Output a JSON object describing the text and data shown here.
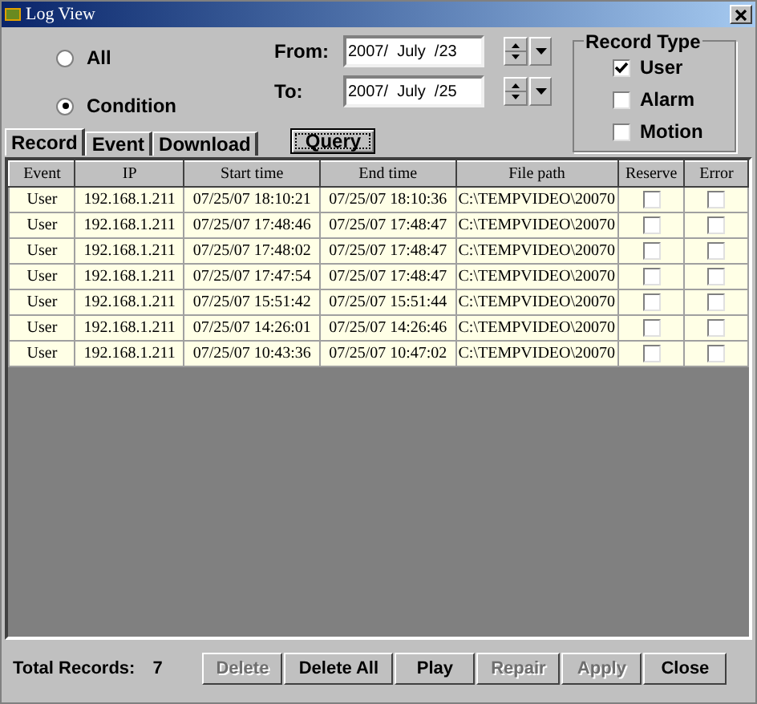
{
  "window": {
    "title": "Log View"
  },
  "range": [
    {
      "label": "All",
      "selected": false
    },
    {
      "label": "Condition",
      "selected": true
    }
  ],
  "dates": [
    {
      "label": "From:",
      "value": "2007/  July  /23"
    },
    {
      "label": "To:",
      "value": "2007/  July  /25"
    }
  ],
  "record_type": {
    "title": "Record Type",
    "options": [
      {
        "label": "User",
        "checked": true
      },
      {
        "label": "Alarm",
        "checked": false
      },
      {
        "label": "Motion",
        "checked": false
      }
    ]
  },
  "tabs": [
    {
      "label": "Record",
      "selected": true
    },
    {
      "label": "Event",
      "selected": false
    },
    {
      "label": "Download",
      "selected": false
    }
  ],
  "query_button": "Query",
  "table": {
    "columns": [
      "Event",
      "IP",
      "Start time",
      "End time",
      "File path",
      "Reserve",
      "Error"
    ],
    "rows": [
      {
        "event": "User",
        "ip": "192.168.1.211",
        "start": "07/25/07 18:10:21",
        "end": "07/25/07 18:10:36",
        "path": "C:\\TEMPVIDEO\\20070",
        "reserve": false,
        "error": false
      },
      {
        "event": "User",
        "ip": "192.168.1.211",
        "start": "07/25/07 17:48:46",
        "end": "07/25/07 17:48:47",
        "path": "C:\\TEMPVIDEO\\20070",
        "reserve": false,
        "error": false
      },
      {
        "event": "User",
        "ip": "192.168.1.211",
        "start": "07/25/07 17:48:02",
        "end": "07/25/07 17:48:47",
        "path": "C:\\TEMPVIDEO\\20070",
        "reserve": false,
        "error": false
      },
      {
        "event": "User",
        "ip": "192.168.1.211",
        "start": "07/25/07 17:47:54",
        "end": "07/25/07 17:48:47",
        "path": "C:\\TEMPVIDEO\\20070",
        "reserve": false,
        "error": false
      },
      {
        "event": "User",
        "ip": "192.168.1.211",
        "start": "07/25/07 15:51:42",
        "end": "07/25/07 15:51:44",
        "path": "C:\\TEMPVIDEO\\20070",
        "reserve": false,
        "error": false
      },
      {
        "event": "User",
        "ip": "192.168.1.211",
        "start": "07/25/07 14:26:01",
        "end": "07/25/07 14:26:46",
        "path": "C:\\TEMPVIDEO\\20070",
        "reserve": false,
        "error": false
      },
      {
        "event": "User",
        "ip": "192.168.1.211",
        "start": "07/25/07 10:43:36",
        "end": "07/25/07 10:47:02",
        "path": "C:\\TEMPVIDEO\\20070",
        "reserve": false,
        "error": false
      }
    ]
  },
  "status_bar": {
    "label": "Total Records:",
    "count": "7"
  },
  "buttons": [
    {
      "label": "Delete",
      "disabled": true
    },
    {
      "label": "Delete All",
      "disabled": false
    },
    {
      "label": "Play",
      "disabled": false
    },
    {
      "label": "Repair",
      "disabled": true
    },
    {
      "label": "Apply",
      "disabled": true
    },
    {
      "label": "Close",
      "disabled": false
    }
  ]
}
